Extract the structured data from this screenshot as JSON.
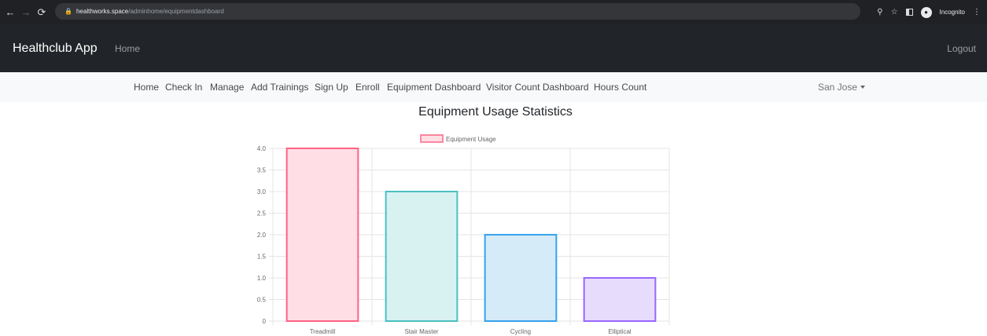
{
  "browser": {
    "url_host": "healthworks.space",
    "url_path": "/adminhome/equipmentdashboard",
    "incognito_label": "Incognito"
  },
  "navbar": {
    "brand": "Healthclub App",
    "home": "Home",
    "logout": "Logout"
  },
  "subnav": {
    "items": [
      "Home",
      "Check In",
      "Manage",
      "Add Trainings",
      "Sign Up",
      "Enroll",
      "Equipment Dashboard",
      "Visitor Count Dashboard",
      "Hours Count"
    ],
    "location": "San Jose"
  },
  "page": {
    "title": "Equipment Usage Statistics"
  },
  "chart_data": {
    "type": "bar",
    "categories": [
      "Treadmill",
      "Stair Master",
      "Cycling",
      "Elliptical"
    ],
    "series": [
      {
        "name": "Equipment Usage",
        "values": [
          4,
          3,
          2,
          1
        ]
      }
    ],
    "ylim": [
      0,
      4
    ],
    "yticks": [
      "0",
      "0.5",
      "1.0",
      "1.5",
      "2.0",
      "2.5",
      "3.0",
      "3.5",
      "4.0"
    ],
    "grid": true,
    "legend": "top-center",
    "colors": {
      "fills": [
        "#ffdfe5",
        "#d8f2f1",
        "#d6ebf8",
        "#e8dcfd"
      ],
      "borders": [
        "#ff6384",
        "#4bc0c0",
        "#36a2eb",
        "#9966ff"
      ],
      "legend_fill": "#ffdfe5",
      "legend_border": "#ff6384"
    }
  }
}
